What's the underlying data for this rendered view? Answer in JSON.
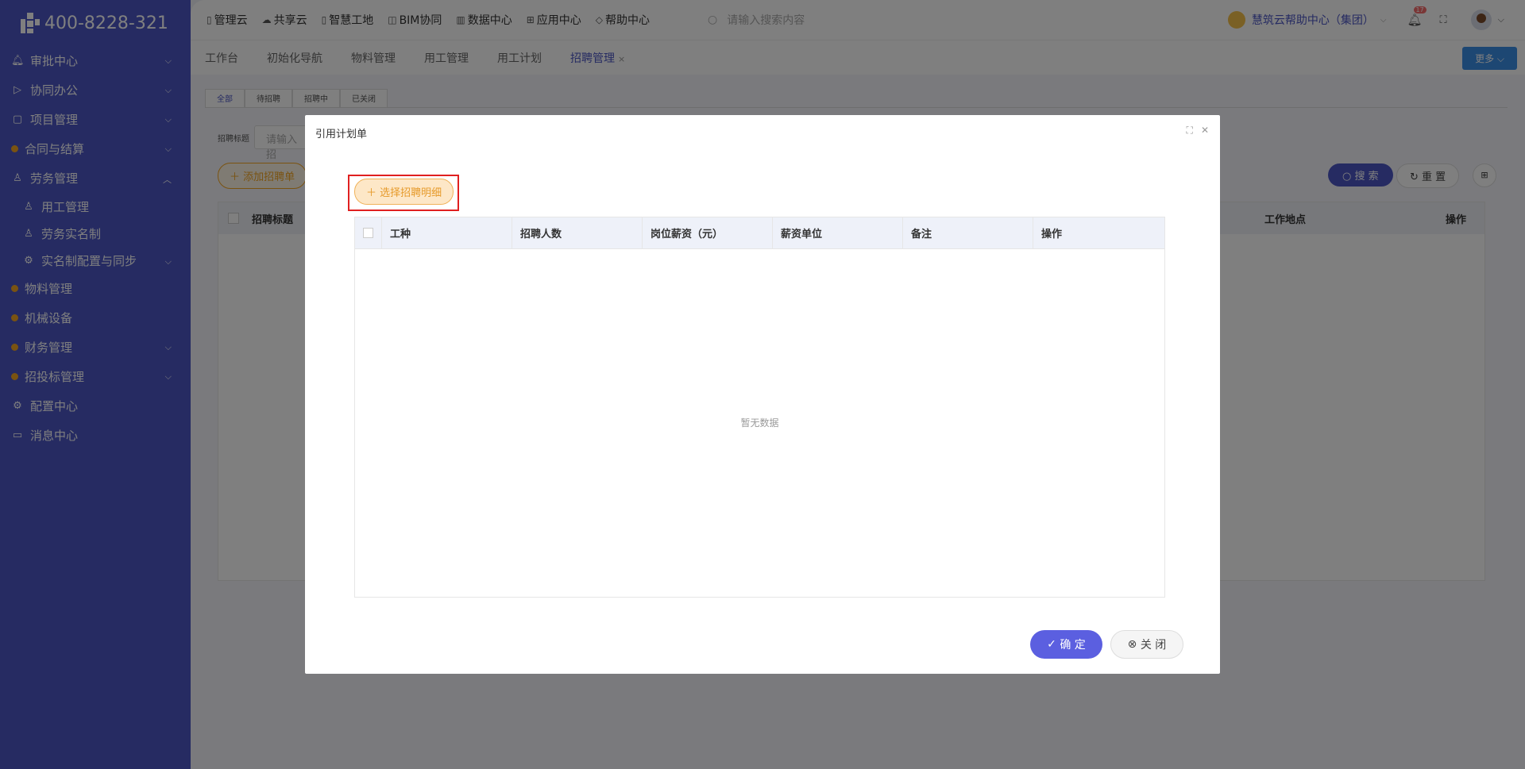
{
  "logo": {
    "phone": "400-8228-321"
  },
  "sidebar": {
    "items": [
      {
        "icon": "bell-icon",
        "label": "审批中心"
      },
      {
        "icon": "send-icon",
        "label": "协同办公"
      },
      {
        "icon": "book-icon",
        "label": "项目管理"
      },
      {
        "icon": "dot-icon",
        "label": "合同与结算"
      },
      {
        "icon": "user-icon",
        "label": "劳务管理"
      },
      {
        "icon": "user-icon",
        "label": "用工管理"
      },
      {
        "icon": "user-icon",
        "label": "劳务实名制"
      },
      {
        "icon": "gear-icon",
        "label": "实名制配置与同步"
      },
      {
        "icon": "dot-icon",
        "label": "物料管理"
      },
      {
        "icon": "dot-icon",
        "label": "机械设备"
      },
      {
        "icon": "dot-icon",
        "label": "财务管理"
      },
      {
        "icon": "dot-icon",
        "label": "招投标管理"
      },
      {
        "icon": "gear-icon",
        "label": "配置中心"
      },
      {
        "icon": "chat-icon",
        "label": "消息中心"
      }
    ]
  },
  "topbar": {
    "links": [
      "管理云",
      "共享云",
      "智慧工地",
      "BIM协同",
      "数据中心",
      "应用中心",
      "帮助中心"
    ],
    "search_placeholder": "请输入搜索内容",
    "org_name": "慧筑云帮助中心（集团）",
    "badge": "17"
  },
  "tabs": [
    "工作台",
    "初始化导航",
    "物料管理",
    "用工管理",
    "用工计划",
    "招聘管理"
  ],
  "more_label": "更多",
  "page": {
    "subtabs": [
      "全部",
      "待招聘",
      "招聘中",
      "已关闭"
    ],
    "filter_label": "招聘标题",
    "filter_placeholder": "请输入招",
    "add_label": "添加招聘单",
    "search_label": "搜 索",
    "reset_label": "重 置",
    "table_headers": {
      "title": "招聘标题",
      "location": "工作地点",
      "action": "操作"
    }
  },
  "dialog": {
    "title": "引用计划单",
    "pick_label": "选择招聘明细",
    "headers": [
      "工种",
      "招聘人数",
      "岗位薪资（元）",
      "薪资单位",
      "备注",
      "操作"
    ],
    "empty_text": "暂无数据",
    "ok_label": "确 定",
    "close_label": "关 闭"
  }
}
